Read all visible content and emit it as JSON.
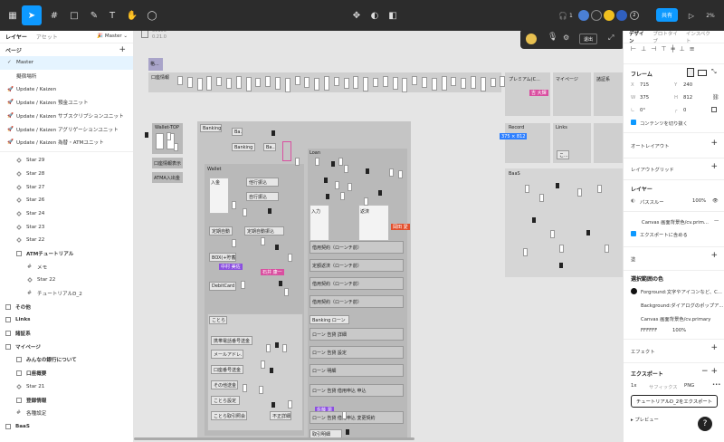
{
  "topbar": {
    "comment_count": "1",
    "avatar_count": "2",
    "share_label": "共有",
    "zoom": "2%",
    "colors": [
      "#4a7fd4",
      "#2f2f2f",
      "#f0c020",
      "#3060c0"
    ]
  },
  "left": {
    "tabs": [
      "レイヤー",
      "アセット"
    ],
    "master_label": "Master",
    "pages_title": "ページ",
    "pages": [
      {
        "label": "Master",
        "selected": true
      },
      {
        "label": "擬宿場所"
      },
      {
        "label": "Update / Kaizen"
      },
      {
        "label": "Update / Kaizen 預金ユニット"
      },
      {
        "label": "Update / Kaizen サブスクリプションユニット"
      },
      {
        "label": "Update / Kaizen アグリゲーションユニット"
      },
      {
        "label": "Update / Kaizen 為替・ATMユニット"
      }
    ],
    "layers": [
      {
        "label": "Star 29",
        "icon": "frame",
        "indent": 18
      },
      {
        "label": "Star 28",
        "icon": "frame",
        "indent": 18
      },
      {
        "label": "Star 27",
        "icon": "frame",
        "indent": 18
      },
      {
        "label": "Star 26",
        "icon": "frame",
        "indent": 18
      },
      {
        "label": "Star 24",
        "icon": "frame",
        "indent": 18
      },
      {
        "label": "Star 23",
        "icon": "frame",
        "indent": 18
      },
      {
        "label": "Star 22",
        "icon": "frame",
        "indent": 18
      },
      {
        "label": "ATMチュートリアル",
        "icon": "grid",
        "indent": 18,
        "bold": true
      },
      {
        "label": "メモ",
        "icon": "hash",
        "indent": 30
      },
      {
        "label": "Star 22",
        "icon": "frame",
        "indent": 30
      },
      {
        "label": "チュートリアルD_2",
        "icon": "hash",
        "indent": 30
      },
      {
        "label": "その他",
        "icon": "grid",
        "indent": 6,
        "bold": true
      },
      {
        "label": "Links",
        "icon": "grid",
        "indent": 6,
        "bold": true
      },
      {
        "label": "諸証系",
        "icon": "grid",
        "indent": 6,
        "bold": true
      },
      {
        "label": "マイページ",
        "icon": "grid",
        "indent": 6,
        "bold": true
      },
      {
        "label": "みんなの銀行について",
        "icon": "grid",
        "indent": 18,
        "bold": true
      },
      {
        "label": "口座概要",
        "icon": "grid",
        "indent": 18,
        "bold": true
      },
      {
        "label": "Star 21",
        "icon": "frame",
        "indent": 18
      },
      {
        "label": "登録情報",
        "icon": "grid",
        "indent": 18,
        "bold": true
      },
      {
        "label": "各種設定",
        "icon": "hash",
        "indent": 18
      },
      {
        "label": "BaaS",
        "icon": "grid",
        "indent": 6,
        "bold": true
      }
    ]
  },
  "canvas": {
    "labels": {
      "version_a": "39150",
      "version_b": "0.21.0",
      "wallet_top": "Wallet-TOP",
      "banking": "Banking",
      "banking2": "Banking",
      "ba1": "Ba...",
      "ba2": "Ba...",
      "wallet": "Wallet",
      "loan": "Loan",
      "kouza": "口座情報表示",
      "atm": "ATMA入出金",
      "premium": "プレミアム(C...",
      "mypage": "マイページ",
      "shoushou": "諸証系",
      "record": "Record",
      "links": "Links",
      "baas": "BaaS",
      "ko": "こ...",
      "kakuka": "格...",
      "kouza_ichiran": "口座情報",
      "nyukin": "入金",
      "shokai": "他行振込",
      "jikou": "自行振込",
      "teiki": "定期自動",
      "teiki2": "定期自動振込",
      "box": "BOX(+貯蓄)",
      "debit": "DebitCard",
      "kotora": "ことら",
      "kotora1": "携帯電話番号送金",
      "kotora2": "メールアドレ...",
      "kotora3": "口座番号送金",
      "kotora4": "その他送金",
      "kotora5": "ことら設定",
      "kotora6": "ことら取引照会",
      "kotora7": "不正詳細",
      "loan1": "借用契約（ローンチ前）",
      "loan2": "定額返済（ローンチ前）",
      "loan3": "借用契約（ローンチ前）",
      "loan4": "借用契約（ローンチ前）",
      "loan_title": "Banking ローン",
      "loan5": "ローン 告貸 詳細",
      "loan6": "ローン 告貸 設定",
      "loan7": "ローン 明細",
      "loan8": "ローン 告貸 借用申込 申込",
      "loan9": "ローン 告貸 借用申込 変更契約",
      "nyuka": "入力",
      "hensai": "返済",
      "torihiki": "取引明細"
    },
    "tags": [
      {
        "text": "吉 大輝",
        "color": "#d94fa0"
      },
      {
        "text": "375 × 812",
        "color": "#2d7fff"
      },
      {
        "text": "中村 美佐",
        "color": "#8b4fe0"
      },
      {
        "text": "石井 康一",
        "color": "#d94fa0"
      },
      {
        "text": "岡田 愛",
        "color": "#e2502d"
      },
      {
        "text": "佐藤 潤",
        "color": "#8b4fe0"
      }
    ]
  },
  "floating": {
    "label": "退出"
  },
  "right": {
    "tabs": [
      "デザイン",
      "プロトタイプ",
      "インスペクト"
    ],
    "frame_title": "フレーム",
    "x_label": "X",
    "x_value": "715",
    "y_label": "Y",
    "y_value": "240",
    "w_label": "W",
    "w_value": "375",
    "h_label": "H",
    "h_value": "812",
    "rot_value": "0°",
    "radius_value": "0",
    "clip_label": "コンテンツを切り抜く",
    "auto_layout": "オートレイアウト",
    "layout_grid": "レイアウトグリッド",
    "layer_title": "レイヤー",
    "passthrough": "パススルー",
    "opacity": "100%",
    "canvas_bg": "Canvas 画面背景色/cv.prim...",
    "export_include": "エクスポートに含める",
    "fill": "塗",
    "selection_colors": "選択範囲の色",
    "sel1": "Forground:文字やアイコンなど、C...",
    "sel2": "Background:ダイアログのポップア...",
    "sel3": "Canvas 画面背景色/cv.primary",
    "sel4_hex": "FFFFFF",
    "sel4_pct": "100%",
    "effect": "エフェクト",
    "export_title": "エクスポート",
    "scale": "1x",
    "suffix": "サフィックス",
    "format": "PNG",
    "export_button": "チュートリアルD_2をエクスポート",
    "preview": "プレビュー",
    "help": "?"
  }
}
